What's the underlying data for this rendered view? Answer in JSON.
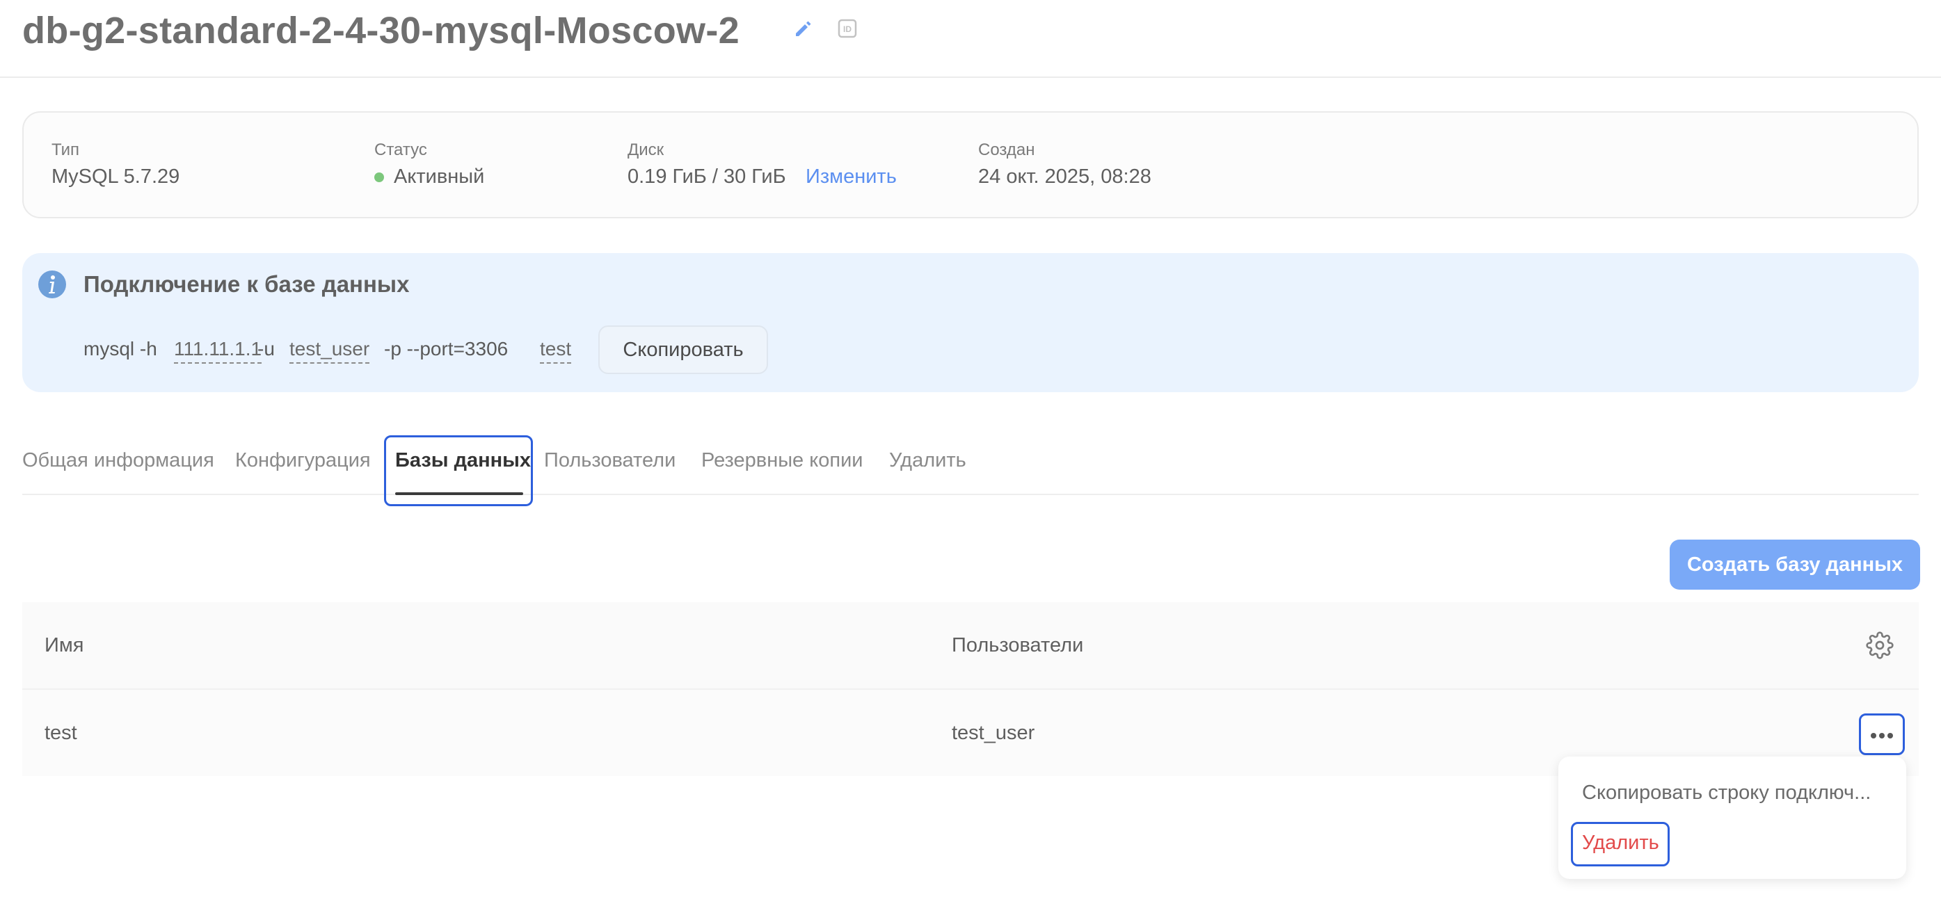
{
  "header": {
    "title": "db-g2-standard-2-4-30-mysql-Moscow-2",
    "id_icon": "ID"
  },
  "info": {
    "type_label": "Тип",
    "type_value": "MySQL 5.7.29",
    "status_label": "Статус",
    "status_value": "Активный",
    "status_color": "#7cc77c",
    "disk_label": "Диск",
    "disk_value": "0.19 ГиБ / 30 ГиБ",
    "disk_change_link": "Изменить",
    "created_label": "Создан",
    "created_value": "24 окт. 2025, 08:28"
  },
  "connection": {
    "title": "Подключение к базе данных",
    "cmd_prefix": "mysql -h",
    "host": "111.11.1.1",
    "user_flag": "-u",
    "user": "test_user",
    "port_part": "-p --port=3306",
    "database": "test",
    "copy_button": "Скопировать"
  },
  "tabs": [
    {
      "label": "Общая информация"
    },
    {
      "label": "Конфигурация"
    },
    {
      "label": "Базы данных"
    },
    {
      "label": "Пользователи"
    },
    {
      "label": "Резервные копии"
    },
    {
      "label": "Удалить"
    }
  ],
  "active_tab": "Базы данных",
  "create_button": "Создать базу данных",
  "table": {
    "headers": {
      "name": "Имя",
      "users": "Пользователи"
    },
    "rows": [
      {
        "name": "test",
        "users": "test_user"
      }
    ]
  },
  "menu": {
    "copy_connection": "Скопировать строку подключ...",
    "delete": "Удалить"
  },
  "colors": {
    "accent": "#7aa9f7",
    "focus": "#2d5fdc",
    "danger": "#e24a4a",
    "connection_bg": "#eaf3fe",
    "link": "#5b8ff0"
  },
  "icons": [
    "edit-icon",
    "id-icon",
    "info-icon",
    "gear-icon",
    "more-horizontal-icon"
  ]
}
